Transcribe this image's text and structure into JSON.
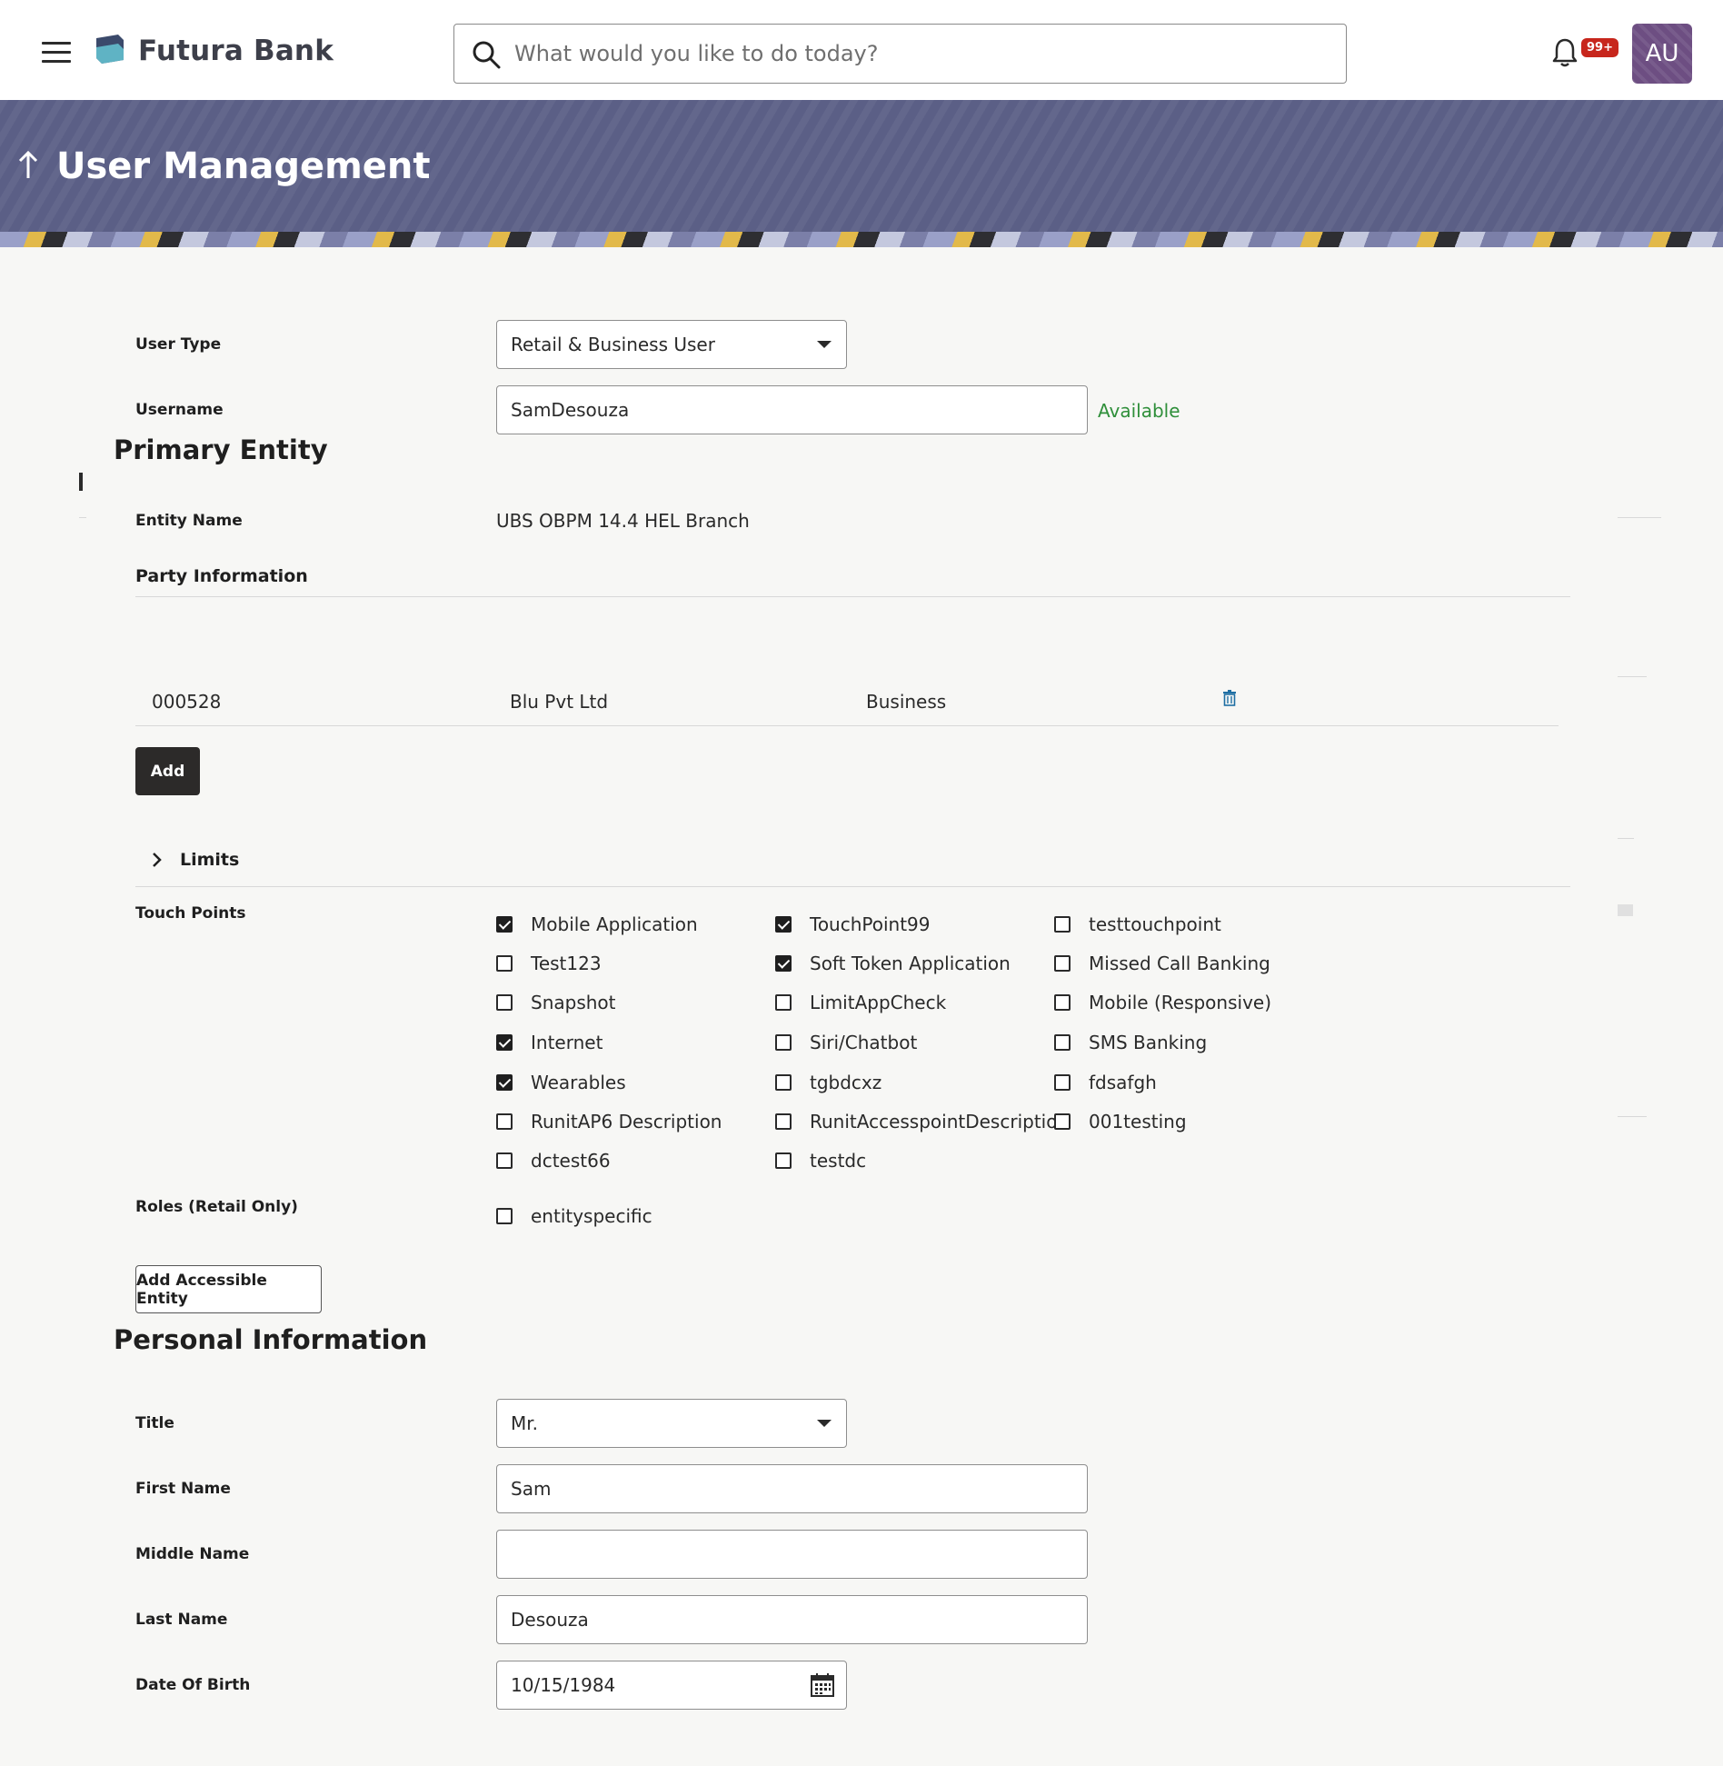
{
  "header": {
    "brand": "Futura Bank",
    "search_placeholder": "What would you like to do today?",
    "notification_count": "99+",
    "avatar_initials": "AU"
  },
  "banner": {
    "title": "User Management"
  },
  "form": {
    "user_type": {
      "label": "User Type",
      "value": "Retail & Business User"
    },
    "username": {
      "label": "Username",
      "value": "SamDesouza",
      "status": "Available"
    },
    "primary_entity": {
      "title": "Primary Entity",
      "entity_name_label": "Entity Name",
      "entity_name_value": "UBS OBPM 14.4 HEL Branch",
      "party_info_title": "Party Information",
      "party_row": {
        "id": "000528",
        "name": "Blu Pvt Ltd",
        "type": "Business"
      },
      "add_label": "Add",
      "limits_label": "Limits"
    },
    "touch_points": {
      "label": "Touch Points",
      "items": [
        {
          "label": "Mobile Application",
          "checked": true
        },
        {
          "label": "TouchPoint99",
          "checked": true
        },
        {
          "label": "testtouchpoint",
          "checked": false
        },
        {
          "label": "Test123",
          "checked": false
        },
        {
          "label": "Soft Token Application",
          "checked": true
        },
        {
          "label": "Missed Call Banking",
          "checked": false
        },
        {
          "label": "Snapshot",
          "checked": false
        },
        {
          "label": "LimitAppCheck",
          "checked": false
        },
        {
          "label": "Mobile (Responsive)",
          "checked": false
        },
        {
          "label": "Internet",
          "checked": true
        },
        {
          "label": "Siri/Chatbot",
          "checked": false
        },
        {
          "label": "SMS Banking",
          "checked": false
        },
        {
          "label": "Wearables",
          "checked": true
        },
        {
          "label": "tgbdcxz",
          "checked": false
        },
        {
          "label": "fdsafgh",
          "checked": false
        },
        {
          "label": "RunitAP6 Description",
          "checked": false
        },
        {
          "label": "RunitAccesspointDescription",
          "checked": false
        },
        {
          "label": "001testing",
          "checked": false
        },
        {
          "label": "dctest66",
          "checked": false
        },
        {
          "label": "testdc",
          "checked": false
        }
      ]
    },
    "roles": {
      "label": "Roles (Retail Only)",
      "items": [
        {
          "label": "entityspecific",
          "checked": false
        }
      ]
    },
    "add_accessible_entity_label": "Add Accessible Entity",
    "personal": {
      "title": "Personal Information",
      "title_label": "Title",
      "title_value": "Mr.",
      "first_name_label": "First Name",
      "first_name_value": "Sam",
      "middle_name_label": "Middle Name",
      "middle_name_value": "",
      "last_name_label": "Last Name",
      "last_name_value": "Desouza",
      "dob_label": "Date Of Birth",
      "dob_value": "10/15/1984"
    }
  }
}
